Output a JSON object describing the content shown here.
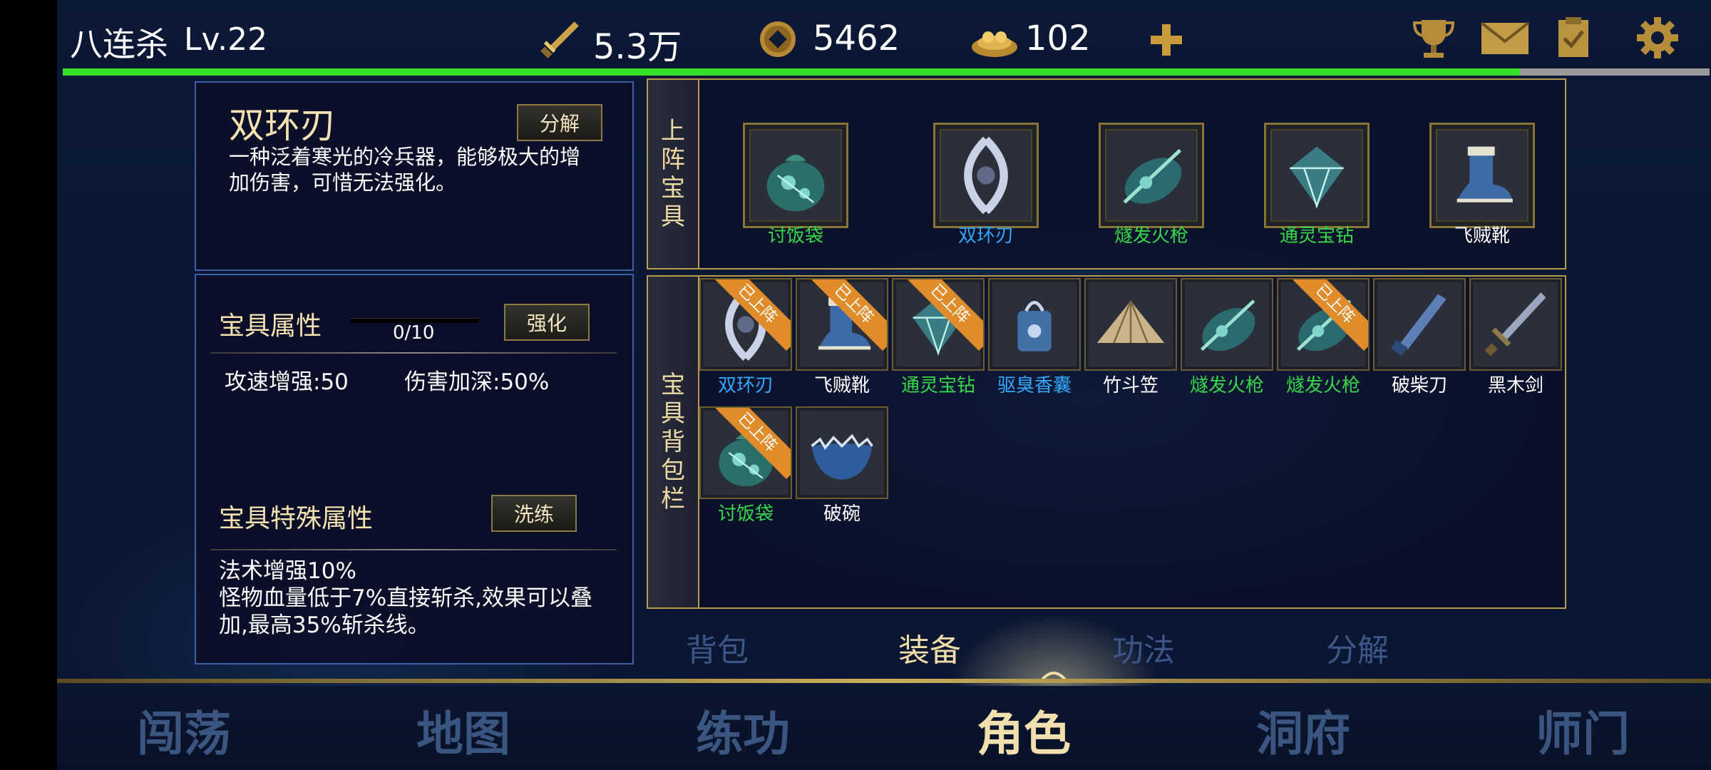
{
  "player": {
    "name": "八连杀",
    "level": "Lv.22"
  },
  "currencies": {
    "power": "5.3万",
    "coins": "5462",
    "ingots": "102"
  },
  "hp_progress": 0.885,
  "top_icons": [
    "plus-icon",
    "trophy-icon",
    "mail-icon",
    "quest-scroll-icon",
    "gear-icon"
  ],
  "detail": {
    "item_name": "双环刃",
    "description": "一种泛着寒光的冷兵器，能够极大的增加伤害，可惜无法强化。",
    "dismantle_label": "分解"
  },
  "attrs": {
    "title": "宝具属性",
    "progress_text": "0/10",
    "enhance_label": "强化",
    "stats": [
      "攻速增强:50",
      "伤害加深:50%"
    ],
    "special_title": "宝具特殊属性",
    "reroll_label": "洗练",
    "special_lines": [
      "法术增强10%",
      "怪物血量低于7%直接斩杀,效果可以叠加,最高35%斩杀线。"
    ]
  },
  "equipped": {
    "label": "上阵宝具",
    "items": [
      {
        "name": "讨饭袋",
        "color": "green",
        "icon": "bag-icon"
      },
      {
        "name": "双环刃",
        "color": "blue",
        "icon": "twin-blade-icon"
      },
      {
        "name": "燧发火枪",
        "color": "green",
        "icon": "musket-icon"
      },
      {
        "name": "通灵宝钻",
        "color": "green",
        "icon": "diamond-icon"
      },
      {
        "name": "飞贼靴",
        "color": "white",
        "icon": "boot-icon"
      }
    ]
  },
  "bag": {
    "label": "宝具背包栏",
    "equipped_ribbon": "已上阵",
    "items": [
      {
        "name": "双环刃",
        "color": "blue",
        "icon": "twin-blade-icon",
        "equipped": true
      },
      {
        "name": "飞贼靴",
        "color": "white",
        "icon": "boot-icon",
        "equipped": true
      },
      {
        "name": "通灵宝钻",
        "color": "green",
        "icon": "diamond-icon",
        "equipped": true
      },
      {
        "name": "驱臭香囊",
        "color": "blue",
        "icon": "sachet-icon",
        "equipped": false
      },
      {
        "name": "竹斗笠",
        "color": "white",
        "icon": "bamboo-hat-icon",
        "equipped": false
      },
      {
        "name": "燧发火枪",
        "color": "green",
        "icon": "musket-icon",
        "equipped": false
      },
      {
        "name": "燧发火枪",
        "color": "green",
        "icon": "musket-icon",
        "equipped": true
      },
      {
        "name": "破柴刀",
        "color": "white",
        "icon": "machete-icon",
        "equipped": false
      },
      {
        "name": "黑木剑",
        "color": "white",
        "icon": "sword-icon",
        "equipped": false
      },
      {
        "name": "讨饭袋",
        "color": "green",
        "icon": "bag-icon",
        "equipped": true
      },
      {
        "name": "破碗",
        "color": "white",
        "icon": "broken-bowl-icon",
        "equipped": false
      }
    ]
  },
  "subtabs": {
    "items": [
      "背包",
      "装备",
      "功法",
      "分解"
    ],
    "active": 1
  },
  "nav": {
    "items": [
      "闯荡",
      "地图",
      "练功",
      "角色",
      "洞府",
      "师门"
    ],
    "active": 3
  },
  "colors": {
    "green": "#36d84a",
    "blue": "#33a8ff",
    "white": "#ffffff",
    "gold": "#b79a4a",
    "hp": "#35e02a"
  }
}
